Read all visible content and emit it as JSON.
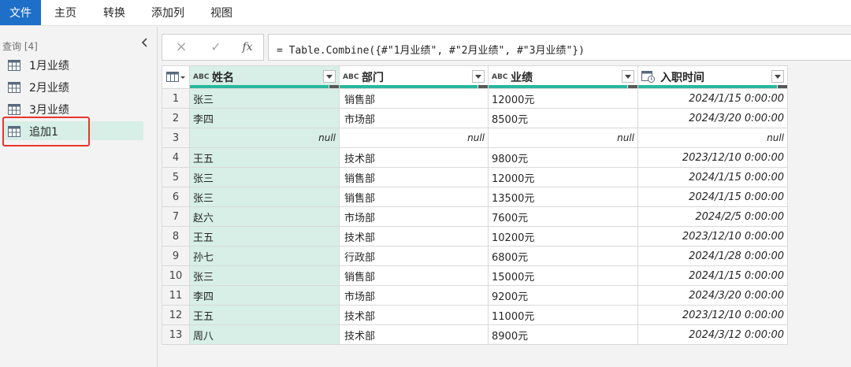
{
  "menu": {
    "tabs": [
      "文件",
      "主页",
      "转换",
      "添加列",
      "视图"
    ]
  },
  "queries": {
    "header": "查询 [4]",
    "items": [
      {
        "label": "1月业绩"
      },
      {
        "label": "2月业绩"
      },
      {
        "label": "3月业绩"
      },
      {
        "label": "追加1",
        "selected": true
      }
    ]
  },
  "formula_bar": {
    "cancel_icon": "×",
    "confirm_icon": "✓",
    "fx_icon": "fx",
    "formula": "= Table.Combine({#\"1月业绩\", #\"2月业绩\", #\"3月业绩\"})"
  },
  "grid": {
    "columns": [
      {
        "type_icon": "ABC",
        "name": "姓名"
      },
      {
        "type_icon": "ABC",
        "name": "部门"
      },
      {
        "type_icon": "ABC",
        "name": "业绩"
      },
      {
        "type_icon": "date-time-icon",
        "name": "入职时间"
      }
    ],
    "column_quality_valid": [
      0.93,
      0.93,
      0.93,
      0.93
    ],
    "rows": [
      {
        "n": "1",
        "name": "张三",
        "dept": "销售部",
        "perf": "12000元",
        "date": "2024/1/15 0:00:00"
      },
      {
        "n": "2",
        "name": "李四",
        "dept": "市场部",
        "perf": "8500元",
        "date": "2024/3/20 0:00:00"
      },
      {
        "n": "3",
        "name": "null",
        "dept": "null",
        "perf": "null",
        "date": "null"
      },
      {
        "n": "4",
        "name": "王五",
        "dept": "技术部",
        "perf": "9800元",
        "date": "2023/12/10 0:00:00"
      },
      {
        "n": "5",
        "name": "张三",
        "dept": "销售部",
        "perf": "12000元",
        "date": "2024/1/15 0:00:00"
      },
      {
        "n": "6",
        "name": "张三",
        "dept": "销售部",
        "perf": "13500元",
        "date": "2024/1/15 0:00:00"
      },
      {
        "n": "7",
        "name": "赵六",
        "dept": "市场部",
        "perf": "7600元",
        "date": "2024/2/5 0:00:00"
      },
      {
        "n": "8",
        "name": "王五",
        "dept": "技术部",
        "perf": "10200元",
        "date": "2023/12/10 0:00:00"
      },
      {
        "n": "9",
        "name": "孙七",
        "dept": "行政部",
        "perf": "6800元",
        "date": "2024/1/28 0:00:00"
      },
      {
        "n": "10",
        "name": "张三",
        "dept": "销售部",
        "perf": "15000元",
        "date": "2024/1/15 0:00:00"
      },
      {
        "n": "11",
        "name": "李四",
        "dept": "市场部",
        "perf": "9200元",
        "date": "2024/3/20 0:00:00"
      },
      {
        "n": "12",
        "name": "王五",
        "dept": "技术部",
        "perf": "11000元",
        "date": "2023/12/10 0:00:00"
      },
      {
        "n": "13",
        "name": "周八",
        "dept": "技术部",
        "perf": "8900元",
        "date": "2024/3/12 0:00:00"
      }
    ]
  },
  "colors": {
    "file_tab": "#1e6fc8",
    "selected_bg": "#d7efe6",
    "quality_ok": "#28b79e",
    "highlight": "#e8352e"
  }
}
